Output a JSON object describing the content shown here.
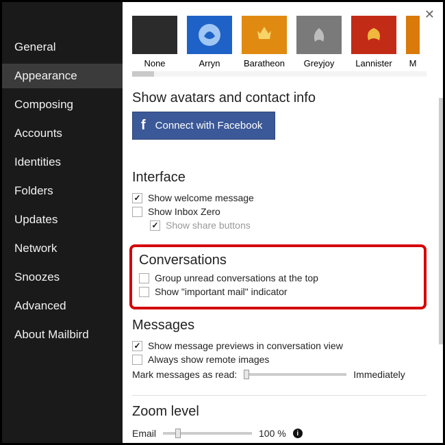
{
  "sidebar": {
    "items": [
      {
        "label": "General"
      },
      {
        "label": "Appearance"
      },
      {
        "label": "Composing"
      },
      {
        "label": "Accounts"
      },
      {
        "label": "Identities"
      },
      {
        "label": "Folders"
      },
      {
        "label": "Updates"
      },
      {
        "label": "Network"
      },
      {
        "label": "Snoozes"
      },
      {
        "label": "Advanced"
      },
      {
        "label": "About Mailbird"
      }
    ],
    "active_index": 1
  },
  "themes": [
    {
      "label": "None",
      "bg": "#2b2b2b"
    },
    {
      "label": "Arryn",
      "bg": "#1e62c7"
    },
    {
      "label": "Baratheon",
      "bg": "#e08a11"
    },
    {
      "label": "Greyjoy",
      "bg": "#7a7a7a"
    },
    {
      "label": "Lannister",
      "bg": "#c22b16"
    },
    {
      "label": "M",
      "bg": "#d97a0b"
    }
  ],
  "avatars": {
    "title": "Show avatars and contact info",
    "button": "Connect with Facebook"
  },
  "interface": {
    "title": "Interface",
    "opts": [
      {
        "label": "Show welcome message",
        "checked": true
      },
      {
        "label": "Show Inbox Zero",
        "checked": false
      },
      {
        "label": "Show share buttons",
        "checked": true,
        "indent": true,
        "muted": true
      }
    ]
  },
  "conversations": {
    "title": "Conversations",
    "opts": [
      {
        "label": "Group unread conversations at the top",
        "checked": false
      },
      {
        "label": "Show \"important mail\" indicator",
        "checked": false
      }
    ]
  },
  "messages": {
    "title": "Messages",
    "opts": [
      {
        "label": "Show message previews in conversation view",
        "checked": true
      },
      {
        "label": "Always show remote images",
        "checked": false
      }
    ],
    "mark_label": "Mark messages as read:",
    "mark_value": "Immediately"
  },
  "zoom": {
    "title": "Zoom level",
    "email_label": "Email",
    "email_value": "100 %"
  }
}
